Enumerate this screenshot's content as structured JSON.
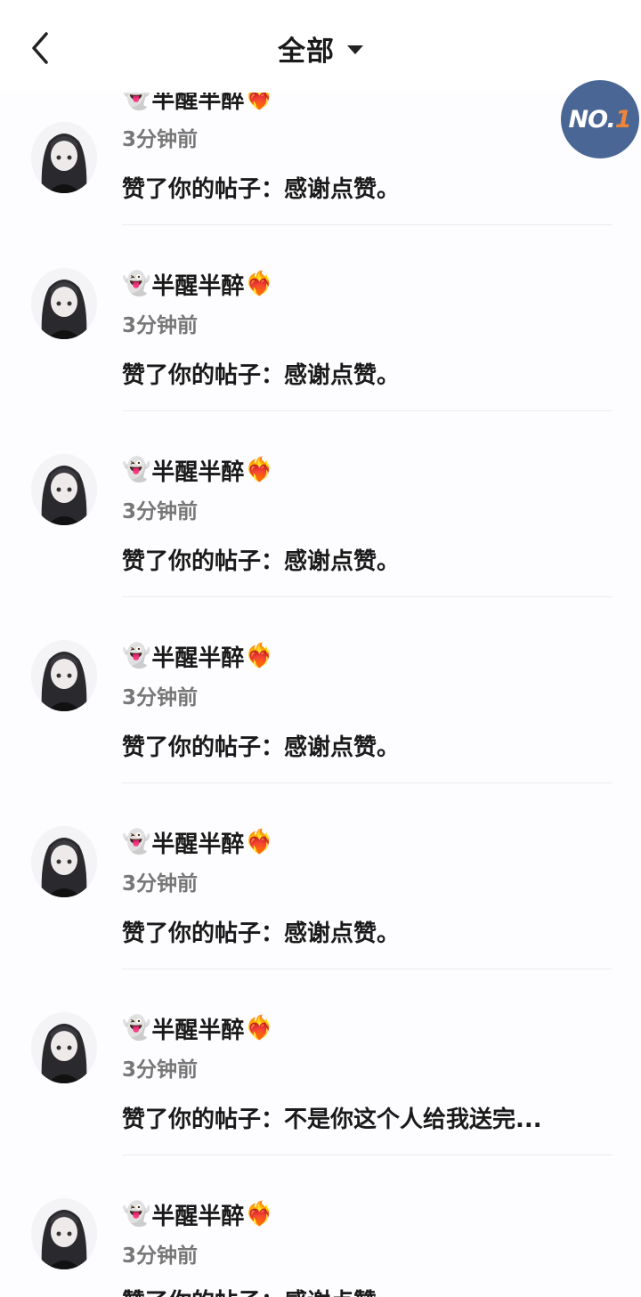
{
  "header": {
    "title": "全部",
    "back_icon": "chevron-left-icon",
    "dropdown_icon": "caret-down-icon"
  },
  "badge": {
    "prefix": "NO.",
    "number": "1",
    "color_bg": "#4a6694",
    "color_number": "#f0843a"
  },
  "notifications": [
    {
      "emoji_left": "👻",
      "name": "半醒半醉",
      "emoji_right": "❤️‍🔥",
      "time": "3分钟前",
      "content": "赞了你的帖子：感谢点赞。"
    },
    {
      "emoji_left": "👻",
      "name": "半醒半醉",
      "emoji_right": "❤️‍🔥",
      "time": "3分钟前",
      "content": "赞了你的帖子：感谢点赞。"
    },
    {
      "emoji_left": "👻",
      "name": "半醒半醉",
      "emoji_right": "❤️‍🔥",
      "time": "3分钟前",
      "content": "赞了你的帖子：感谢点赞。"
    },
    {
      "emoji_left": "👻",
      "name": "半醒半醉",
      "emoji_right": "❤️‍🔥",
      "time": "3分钟前",
      "content": "赞了你的帖子：感谢点赞。"
    },
    {
      "emoji_left": "👻",
      "name": "半醒半醉",
      "emoji_right": "❤️‍🔥",
      "time": "3分钟前",
      "content": "赞了你的帖子：感谢点赞。"
    },
    {
      "emoji_left": "👻",
      "name": "半醒半醉",
      "emoji_right": "❤️‍🔥",
      "time": "3分钟前",
      "content": "赞了你的帖子：不是你这个人给我送完..."
    },
    {
      "emoji_left": "👻",
      "name": "半醒半醉",
      "emoji_right": "❤️‍🔥",
      "time": "3分钟前",
      "content": "赞了你的帖子：感谢点赞。"
    }
  ]
}
